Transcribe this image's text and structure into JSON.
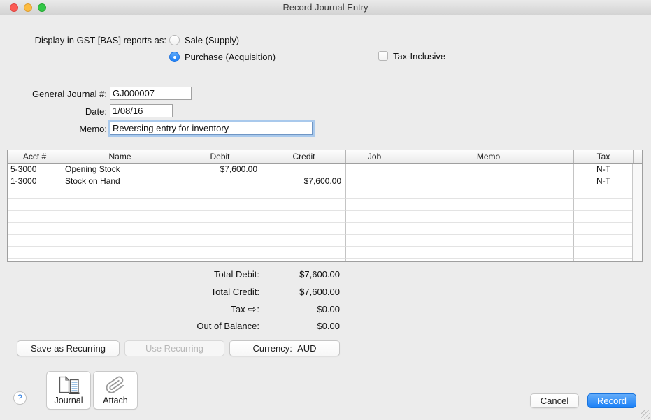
{
  "window": {
    "title": "Record Journal Entry"
  },
  "gst": {
    "label": "Display in GST [BAS] reports as:",
    "sale": {
      "label": "Sale (Supply)",
      "selected": false
    },
    "purchase": {
      "label": "Purchase (Acquisition)",
      "selected": true
    },
    "tax_inclusive": {
      "label": "Tax-Inclusive",
      "checked": false
    }
  },
  "fields": {
    "journal_number": {
      "label": "General Journal #:",
      "value": "GJ000007"
    },
    "date": {
      "label": "Date:",
      "value": "1/08/16"
    },
    "memo": {
      "label": "Memo:",
      "value": "Reversing entry for inventory",
      "focused": true
    }
  },
  "table": {
    "columns": [
      "Acct #",
      "Name",
      "Debit",
      "Credit",
      "Job",
      "Memo",
      "Tax"
    ],
    "rows": [
      {
        "acct": "5-3000",
        "name": "Opening Stock",
        "debit": "$7,600.00",
        "credit": "",
        "job": "",
        "memo": "",
        "tax": "N-T"
      },
      {
        "acct": "1-3000",
        "name": "Stock on Hand",
        "debit": "",
        "credit": "$7,600.00",
        "job": "",
        "memo": "",
        "tax": "N-T"
      }
    ],
    "empty_row_count": 7
  },
  "totals": {
    "debit": {
      "label": "Total Debit:",
      "value": "$7,600.00"
    },
    "credit": {
      "label": "Total Credit:",
      "value": "$7,600.00"
    },
    "tax": {
      "label": "Tax",
      "arrow": "⇨",
      "colon": ":",
      "value": "$0.00"
    },
    "out_of_balance": {
      "label": "Out of Balance:",
      "value": "$0.00"
    }
  },
  "buttons": {
    "save_as_recurring": "Save as Recurring",
    "use_recurring": "Use Recurring",
    "currency_label": "Currency:",
    "currency_value": "AUD",
    "cancel": "Cancel",
    "record": "Record",
    "journal": "Journal",
    "attach": "Attach",
    "help": "?"
  },
  "colors": {
    "record_blue": "#1a80f7",
    "radio_selected_blue": "#1c7ef5",
    "focus_ring_blue": "#a9c9ec",
    "journal_icon_lines_blue": "#5b9bd5",
    "help_question_blue": "#2e7de0",
    "traffic_red": "#fc5b53",
    "traffic_yellow": "#fdbc40",
    "traffic_green": "#33c748"
  }
}
